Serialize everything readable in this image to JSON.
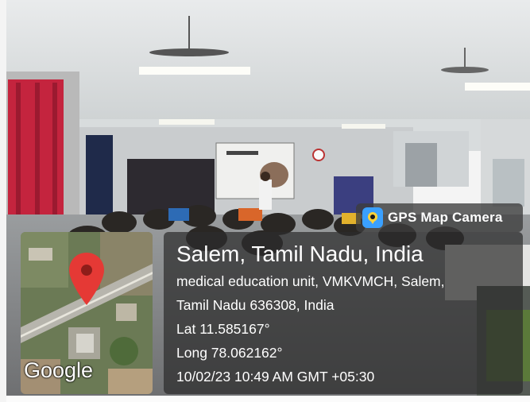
{
  "photo": {
    "scene": "seminar-hall",
    "projector_slide": "Scientific Writing"
  },
  "badge": {
    "label": "GPS Map Camera",
    "icon": "camera-pin-icon"
  },
  "map": {
    "brand": "Google",
    "pin_icon": "location-pin-icon",
    "pin_color": "#e53935"
  },
  "location": {
    "title": "Salem, Tamil Nadu, India",
    "address_line1": "medical education unit, VMKVMCH, Salem,",
    "address_line2": "Tamil Nadu 636308, India",
    "latitude": "Lat 11.585167°",
    "longitude": "Long 78.062162°",
    "datetime": "10/02/23 10:49 AM GMT +05:30"
  }
}
